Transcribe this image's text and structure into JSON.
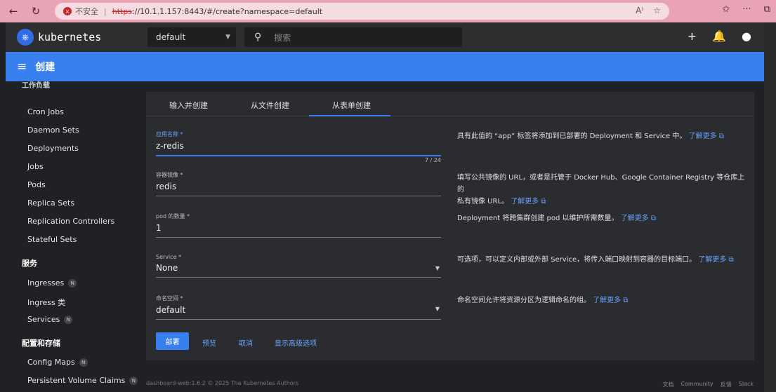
{
  "browser": {
    "back_glyph": "←",
    "reload_glyph": "↻",
    "security_text": "不安全",
    "separator": "|",
    "url_protocol": "https",
    "url_rest": "://10.1.1.157:8443/#/create?namespace=default",
    "read_aloud_glyph": "A⁾",
    "favorite_glyph": "☆",
    "favorites_glyph": "✩",
    "more_glyph": "···",
    "extension_glyph": "⧉"
  },
  "header": {
    "brand": "kubernetes",
    "namespace": "default",
    "search_placeholder": "搜索",
    "add_glyph": "+",
    "bell_glyph": "🔔",
    "account_glyph": "●"
  },
  "title_bar": {
    "menu_glyph": "≡",
    "title": "创建"
  },
  "sidebar": {
    "cut_heading": "工作负载",
    "workloads": [
      "Cron Jobs",
      "Daemon Sets",
      "Deployments",
      "Jobs",
      "Pods",
      "Replica Sets",
      "Replication Controllers",
      "Stateful Sets"
    ],
    "service_heading": "服务",
    "service_items": [
      {
        "label": "Ingresses",
        "badge": "N"
      },
      {
        "label": "Ingress 类",
        "badge": ""
      },
      {
        "label": "Services",
        "badge": "N"
      }
    ],
    "config_heading": "配置和存储",
    "config_items": [
      {
        "label": "Config Maps",
        "badge": "N"
      },
      {
        "label": "Persistent Volume Claims",
        "badge": "N"
      }
    ]
  },
  "tabs": [
    "输入并创建",
    "从文件创建",
    "从表单创建"
  ],
  "form": {
    "app_name": {
      "label": "应用名称 *",
      "value": "z-redis",
      "counter": "7 / 24"
    },
    "image": {
      "label": "容器镜像 *",
      "value": "redis"
    },
    "pods": {
      "label": "pod 的数量 *",
      "value": "1"
    },
    "service": {
      "label": "Service *",
      "value": "None"
    },
    "namespace": {
      "label": "命名空间 *",
      "value": "default"
    }
  },
  "help": {
    "app_name": "具有此值的 “app” 标签将添加到已部署的 Deployment 和 Service 中。",
    "image_1": "填写公共镜像的 URL，或者是托管于 Docker Hub、Google Container Registry 等仓库上的",
    "image_2": "私有镜像 URL。",
    "pods": "Deployment 将跨集群创建 pod 以维护所需数量。",
    "service": "可选项，可以定义内部或外部 Service，将传入端口映射到容器的目标端口。",
    "namespace": "命名空间允许将资源分区为逻辑命名的组。",
    "learn_more": "了解更多 ⧉"
  },
  "actions": {
    "deploy": "部署",
    "preview": "预览",
    "cancel": "取消",
    "advanced": "显示高级选项"
  },
  "footer": {
    "copyright": "dashboard-web:1.6.2 © 2025 The Kubernetes Authors",
    "links": [
      "文档",
      "Community",
      "反馈",
      "Slack"
    ]
  },
  "colors": {
    "accent": "#3880f0",
    "browser_bar": "#e8a3b5",
    "panel": "#2b2c2f",
    "background": "#202124"
  }
}
